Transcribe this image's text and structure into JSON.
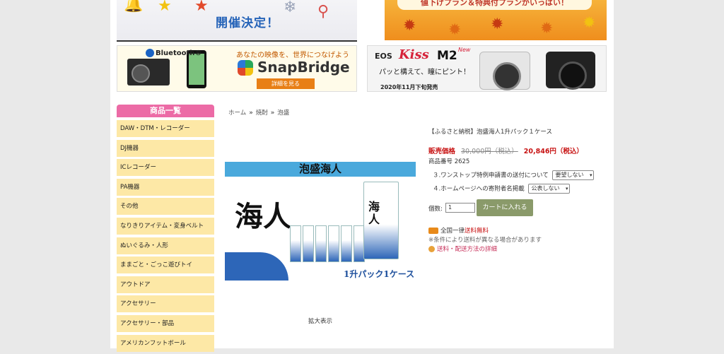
{
  "banners": {
    "xmas": {
      "headline": "開催決定！"
    },
    "autumn": {
      "text": "値下げプラン＆特典付プランがいっぱい！"
    },
    "snapbridge": {
      "bluetooth": "Bluetooth®",
      "tagline": "あなたの映像を、世界につなげよう",
      "logo": "SnapBridge",
      "button": "詳細を見る"
    },
    "eos": {
      "brand": "EOS",
      "kiss": "Kiss",
      "model": "M2",
      "new_badge": "New",
      "copy": "パッと構えて、瞳にピント！",
      "release": "2020年11月下旬発売"
    }
  },
  "sidebar": {
    "header": "商品一覧",
    "categories": [
      "DAW・DTM・レコーダー",
      "DJ機器",
      "ICレコーダー",
      "PA機器",
      "その他",
      "なりきりアイテム・変身ベルト",
      "ぬいぐるみ・人形",
      "ままごと・ごっこ遊びトイ",
      "アウトドア",
      "アクセサリー",
      "アクセサリー・部品",
      "アメリカンフットボール"
    ]
  },
  "breadcrumb": [
    "ホーム",
    "焼酎",
    "泡盛"
  ],
  "product_image": {
    "title": "泡盛海人",
    "kanji": "海人",
    "caption": "1升パック1ケース",
    "zoom_label": "拡大表示"
  },
  "product": {
    "name": "【ふるさと納税】泡盛海人1升パック１ケース",
    "price_label": "販売価格",
    "price_old": "30,000円（税込）",
    "price_new": "20,846円（税込）",
    "sku": "商品番号 2625",
    "option1_label": "３.ワンストップ特例申請書の送付について",
    "option1_value": "要望しない",
    "option2_label": "４.ホームページへの寄附者名掲載",
    "option2_value": "公表しない",
    "qty_label": "個数:",
    "qty_value": "1",
    "cart_button": "カートに入れる",
    "shipping_prefix": "全国一律",
    "shipping_free": "送料無料",
    "shipping_note": "※条件により送料が異なる場合があります",
    "shipping_link": "送料・配送方法の詳細"
  },
  "colors": {
    "sidebar_header": "#ec6ba6",
    "sidebar_item": "#fde8a6",
    "price_red": "#c71111",
    "cart_button": "#8a9a6a"
  }
}
